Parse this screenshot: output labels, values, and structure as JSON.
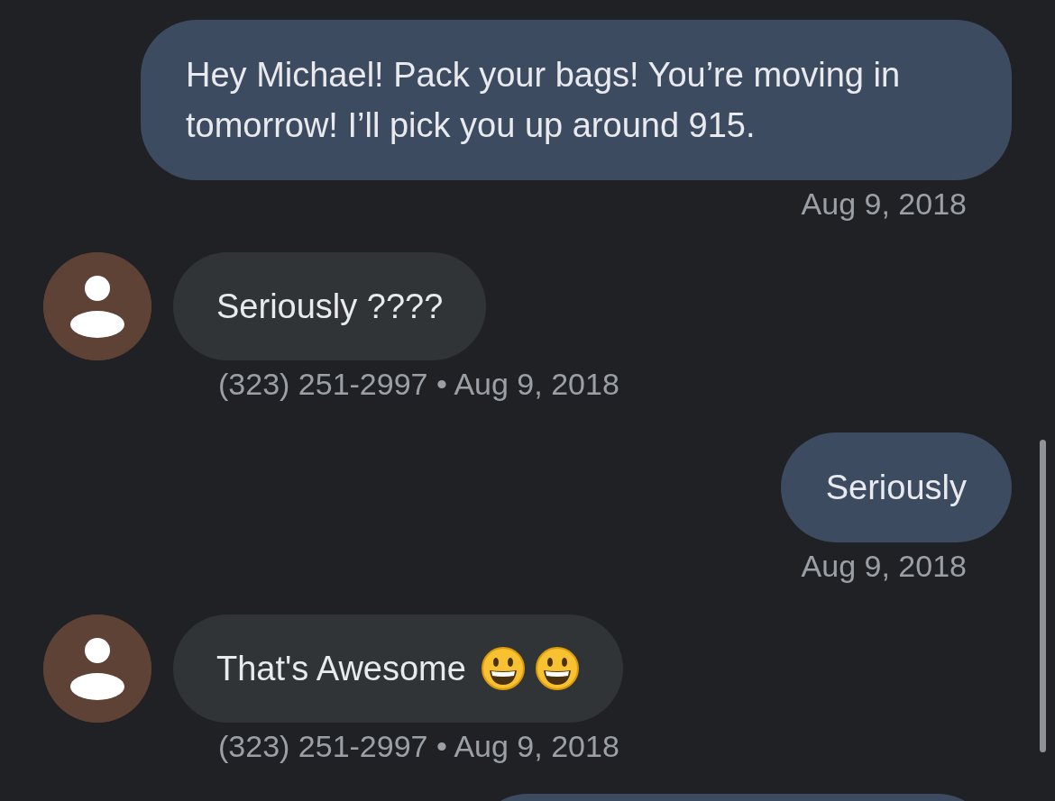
{
  "messages": [
    {
      "kind": "outgoing",
      "text": "Hey Michael! Pack your bags! You’re moving in tomorrow! I’ll pick you up around 915.",
      "meta": "Aug 9, 2018"
    },
    {
      "kind": "incoming",
      "text": "Seriously ????",
      "meta": "(323) 251-2997 • Aug 9, 2018"
    },
    {
      "kind": "outgoing",
      "text": "Seriously",
      "meta": "Aug 9, 2018"
    },
    {
      "kind": "incoming",
      "text": "That's Awesome",
      "emoji": [
        {
          "kind": "grin"
        },
        {
          "kind": "grin"
        }
      ],
      "meta": "(323) 251-2997 • Aug 9, 2018"
    },
    {
      "kind": "outgoing-partial"
    }
  ]
}
